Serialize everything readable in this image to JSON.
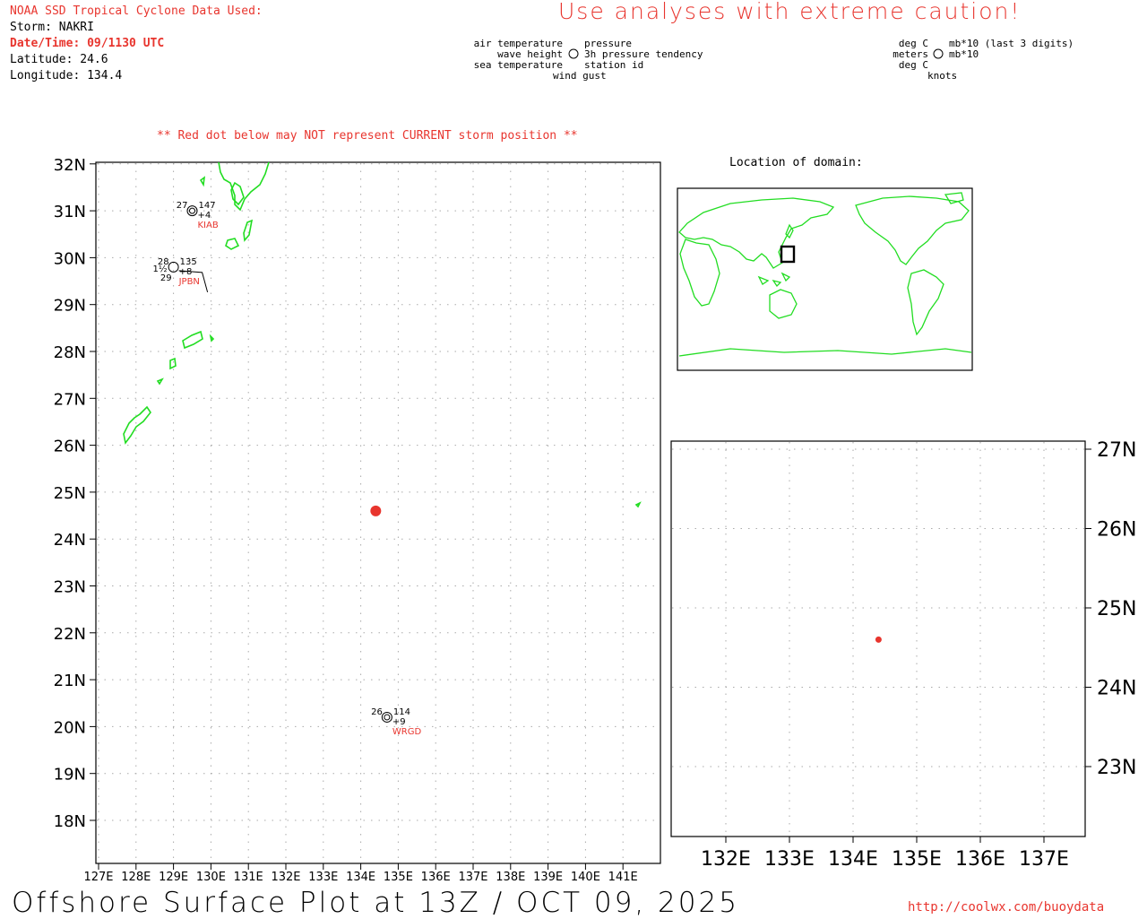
{
  "header": {
    "source_title": "NOAA SSD Tropical Cyclone Data Used:",
    "storm": "Storm: NAKRI",
    "datetime": "Date/Time: 09/1130 UTC",
    "latitude": "Latitude: 24.6",
    "longitude": "Longitude: 134.4",
    "caution": "Use analyses with extreme caution!"
  },
  "legend": {
    "left": {
      "air_temperature": "air temperature",
      "wave_height": "wave height",
      "sea_temperature": "sea temperature",
      "pressure": "pressure",
      "pressure_tendency": "3h pressure tendency",
      "station_id": "station id",
      "wind_gust": "wind gust"
    },
    "right": {
      "deg_c_1": "deg C",
      "meters": "meters",
      "deg_c_2": "deg C",
      "mb10_last3": "mb*10 (last 3 digits)",
      "mb10": "mb*10",
      "knots": "knots"
    }
  },
  "notice": "** Red dot below may NOT represent CURRENT storm position **",
  "inset_title": "Location of domain:",
  "main_map": {
    "lon_ticks": [
      "127E",
      "128E",
      "129E",
      "130E",
      "131E",
      "132E",
      "133E",
      "134E",
      "135E",
      "136E",
      "137E",
      "138E",
      "139E",
      "140E",
      "141E"
    ],
    "lat_ticks": [
      "18N",
      "19N",
      "20N",
      "21N",
      "22N",
      "23N",
      "24N",
      "25N",
      "26N",
      "27N",
      "28N",
      "29N",
      "30N",
      "31N",
      "32N"
    ],
    "storm": {
      "lat": 24.6,
      "lon": 134.4
    },
    "stations": [
      {
        "id": "KIAB",
        "lat": 31.0,
        "lon": 129.5,
        "air_temp": "27",
        "pressure": "147",
        "tendency": "+4"
      },
      {
        "id": "JPBN",
        "lat": 29.8,
        "lon": 129.0,
        "air_temp": "28",
        "wave": "1½",
        "sea_temp": "29",
        "pressure": "135",
        "tendency": "+8"
      },
      {
        "id": "WRGD",
        "lat": 20.2,
        "lon": 134.7,
        "air_temp": "26",
        "pressure": "114",
        "tendency": "+9"
      }
    ]
  },
  "zoom_map": {
    "lon_ticks": [
      "132E",
      "133E",
      "134E",
      "135E",
      "136E",
      "137E"
    ],
    "lat_ticks": [
      "23N",
      "24N",
      "25N",
      "26N",
      "27N"
    ],
    "storm": {
      "lat": 24.6,
      "lon": 134.4
    }
  },
  "footer": {
    "title": "Offshore Surface Plot at 13Z / OCT 09, 2025",
    "url": "http://coolwx.com/buoydata"
  },
  "colors": {
    "land": "#22dd22",
    "storm": "#e8352e",
    "label_red": "#e8352e",
    "grid": "#aaaaaa"
  }
}
